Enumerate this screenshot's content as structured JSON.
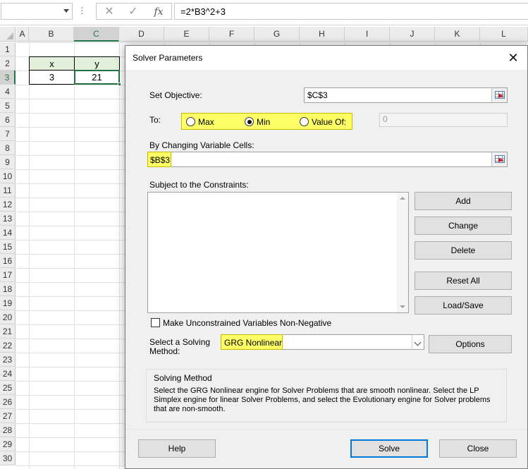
{
  "excel": {
    "name_box": "",
    "formula": "=2*B3^2+3",
    "fx_label": "fx",
    "columns": [
      "A",
      "B",
      "C",
      "D",
      "E",
      "F",
      "G",
      "H",
      "I",
      "J",
      "K",
      "L"
    ],
    "rows": [
      "1",
      "2",
      "3",
      "4",
      "5",
      "6",
      "7",
      "8",
      "9",
      "10",
      "11",
      "12",
      "13",
      "14",
      "15",
      "16",
      "17",
      "18",
      "19",
      "20",
      "21",
      "22",
      "23",
      "24",
      "25",
      "26",
      "27",
      "28",
      "29",
      "30"
    ],
    "table": {
      "header_x": "x",
      "header_y": "y",
      "value_x": "3",
      "value_y": "21"
    }
  },
  "dialog": {
    "title": "Solver Parameters",
    "set_objective_label": "Set Objective:",
    "objective_value": "$C$3",
    "to_label": "To:",
    "radio_max": "Max",
    "radio_min": "Min",
    "radio_value_of": "Value Of:",
    "value_of_field": "0",
    "by_changing_label": "By Changing Variable Cells:",
    "changing_value": "$B$3",
    "constraints_label": "Subject to the Constraints:",
    "buttons": {
      "add": "Add",
      "change": "Change",
      "delete": "Delete",
      "reset_all": "Reset All",
      "load_save": "Load/Save",
      "options": "Options",
      "help": "Help",
      "solve": "Solve",
      "close": "Close"
    },
    "checkbox_label": "Make Unconstrained Variables Non-Negative",
    "select_method_label_1": "Select a Solving",
    "select_method_label_2": "Method:",
    "solving_method": "GRG Nonlinear",
    "method_box_title": "Solving Method",
    "method_description": "Select the GRG Nonlinear engine for Solver Problems that are smooth nonlinear. Select the LP Simplex engine for linear Solver Problems, and select the Evolutionary engine for Solver problems that are non-smooth.",
    "colors": {
      "highlight": "#ffff66",
      "selection": "#217346",
      "table_header": "#e2efda",
      "default_button_border": "#0078d7"
    }
  }
}
